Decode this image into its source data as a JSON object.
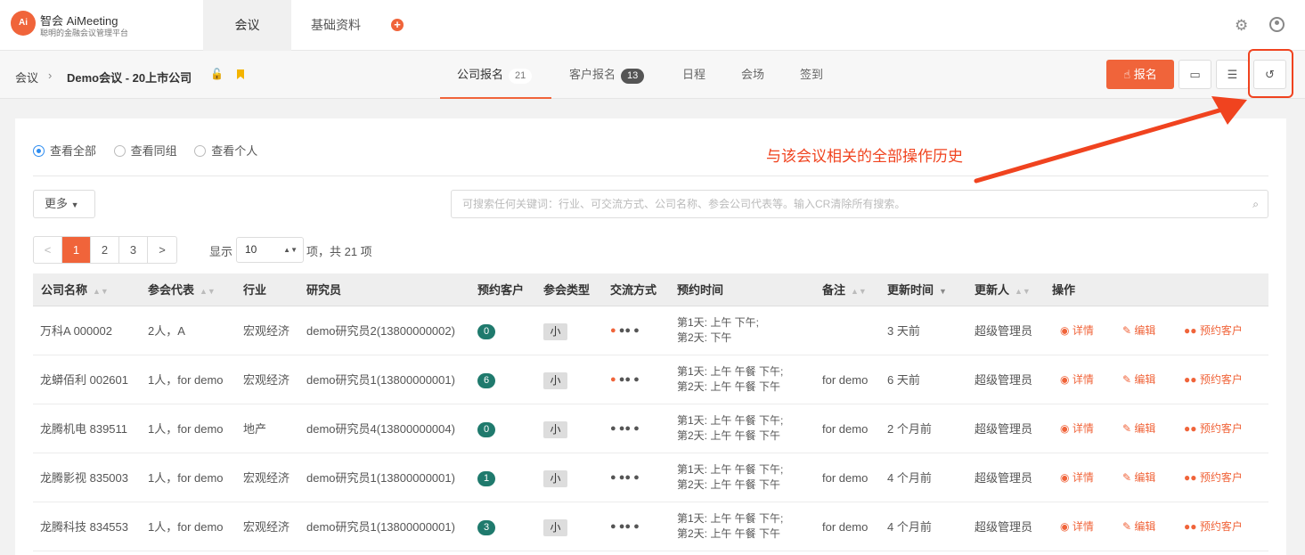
{
  "brand": {
    "name": "智会 AiMeeting",
    "sub": "聪明的金融会议管理平台",
    "logo_text": "Ai"
  },
  "nav": {
    "tabs": [
      "会议",
      "基础资料"
    ]
  },
  "breadcrumb": {
    "root": "会议",
    "current": "Demo会议 - 20上市公司"
  },
  "subtabs": [
    {
      "label": "公司报名",
      "count": "21"
    },
    {
      "label": "客户报名",
      "count": "13"
    },
    {
      "label": "日程"
    },
    {
      "label": "会场"
    },
    {
      "label": "签到"
    }
  ],
  "register_btn": "报名",
  "annotation": "与该会议相关的全部操作历史",
  "filters": {
    "all": "查看全部",
    "group": "查看同组",
    "personal": "查看个人"
  },
  "more": "更多",
  "search_placeholder": "可搜索任何关键词：行业、可交流方式、公司名称、参会公司代表等。输入CR清除所有搜索。",
  "pager": {
    "prev": "<",
    "pages": [
      "1",
      "2",
      "3"
    ],
    "next": ">",
    "show": "显示",
    "size": "10",
    "total": "项，共 21 项"
  },
  "columns": [
    "公司名称",
    "参会代表",
    "行业",
    "研究员",
    "预约客户",
    "参会类型",
    "交流方式",
    "预约时间",
    "备注",
    "更新时间",
    "更新人",
    "操作"
  ],
  "actions": {
    "detail": "详情",
    "edit": "编辑",
    "reserve": "预约客户"
  },
  "rows": [
    {
      "company": "万科A 000002",
      "rep": "2人，A",
      "industry": "宏观经济",
      "researcher": "demo研究员2(13800000002)",
      "count": "0",
      "type": "小",
      "time1": "第1天: 上午 下午;",
      "time2": "第2天: 下午",
      "note": "",
      "updated": "3 天前",
      "updater": "超级管理员",
      "first_orange": true
    },
    {
      "company": "龙蟒佰利 002601",
      "rep": "1人，for demo",
      "industry": "宏观经济",
      "researcher": "demo研究员1(13800000001)",
      "count": "6",
      "type": "小",
      "time1": "第1天: 上午 午餐 下午;",
      "time2": "第2天: 上午 午餐 下午",
      "note": "for demo",
      "updated": "6 天前",
      "updater": "超级管理员",
      "first_orange": true
    },
    {
      "company": "龙腾机电 839511",
      "rep": "1人，for demo",
      "industry": "地产",
      "researcher": "demo研究员4(13800000004)",
      "count": "0",
      "type": "小",
      "time1": "第1天: 上午 午餐 下午;",
      "time2": "第2天: 上午 午餐 下午",
      "note": "for demo",
      "updated": "2 个月前",
      "updater": "超级管理员",
      "first_orange": false
    },
    {
      "company": "龙腾影视 835003",
      "rep": "1人，for demo",
      "industry": "宏观经济",
      "researcher": "demo研究员1(13800000001)",
      "count": "1",
      "type": "小",
      "time1": "第1天: 上午 午餐 下午;",
      "time2": "第2天: 上午 午餐 下午",
      "note": "for demo",
      "updated": "4 个月前",
      "updater": "超级管理员",
      "first_orange": false
    },
    {
      "company": "龙腾科技 834553",
      "rep": "1人，for demo",
      "industry": "宏观经济",
      "researcher": "demo研究员1(13800000001)",
      "count": "3",
      "type": "小",
      "time1": "第1天: 上午 午餐 下午;",
      "time2": "第2天: 上午 午餐 下午",
      "note": "for demo",
      "updated": "4 个月前",
      "updater": "超级管理员",
      "first_orange": false
    }
  ]
}
